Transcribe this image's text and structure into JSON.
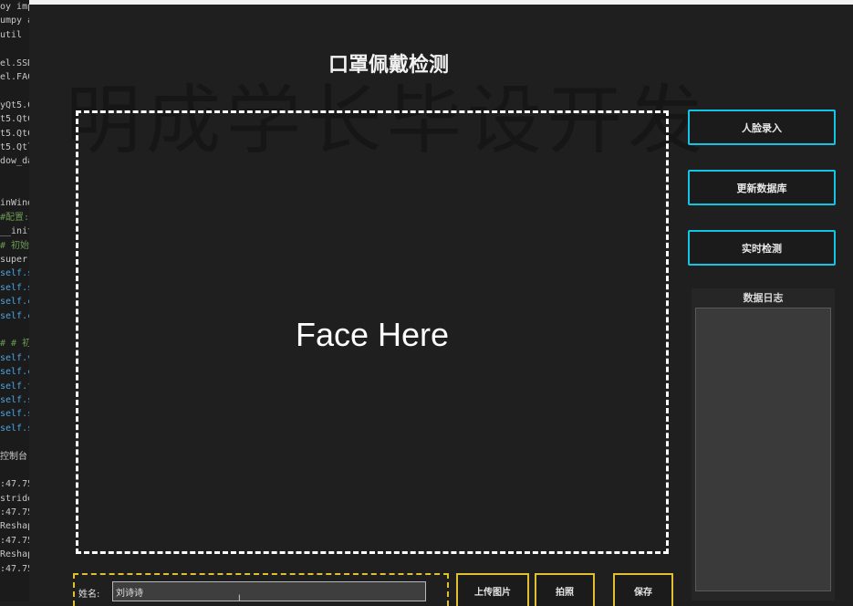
{
  "code_lines": [
    {
      "text": "oy imp",
      "cls": ""
    },
    {
      "text": "umpy a",
      "cls": ""
    },
    {
      "text": "util",
      "cls": ""
    },
    {
      "text": "",
      "cls": ""
    },
    {
      "text": "el.SSD",
      "cls": ""
    },
    {
      "text": "el.FAC",
      "cls": ""
    },
    {
      "text": "",
      "cls": ""
    },
    {
      "text": "yQt5.C",
      "cls": ""
    },
    {
      "text": "t5.QtC",
      "cls": ""
    },
    {
      "text": "t5.QtC",
      "cls": ""
    },
    {
      "text": "t5.Qtl",
      "cls": ""
    },
    {
      "text": "dow_da",
      "cls": ""
    },
    {
      "text": "",
      "cls": ""
    },
    {
      "text": "",
      "cls": ""
    },
    {
      "text": "inWind",
      "cls": ""
    },
    {
      "text": "#配置:",
      "cls": "cm"
    },
    {
      "text": "__init",
      "cls": ""
    },
    {
      "text": "# 初始",
      "cls": "cm"
    },
    {
      "text": "super(",
      "cls": ""
    },
    {
      "text": "self.s",
      "cls": "kw"
    },
    {
      "text": "self.s",
      "cls": "kw"
    },
    {
      "text": "self.c",
      "cls": "kw"
    },
    {
      "text": "self.c",
      "cls": "kw"
    },
    {
      "text": "",
      "cls": ""
    },
    {
      "text": "# # 初",
      "cls": "cm"
    },
    {
      "text": "self.v",
      "cls": "kw"
    },
    {
      "text": "self.c",
      "cls": "kw"
    },
    {
      "text": "self.t",
      "cls": "kw"
    },
    {
      "text": "self.s",
      "cls": "kw"
    },
    {
      "text": "self.s",
      "cls": "kw"
    },
    {
      "text": "self.s",
      "cls": "kw"
    },
    {
      "text": "",
      "cls": ""
    },
    {
      "text": "控制台",
      "cls": ""
    },
    {
      "text": "",
      "cls": ""
    },
    {
      "text": ":47.75",
      "cls": ""
    },
    {
      "text": "stride",
      "cls": ""
    },
    {
      "text": ":47.75",
      "cls": ""
    },
    {
      "text": "Reshap",
      "cls": ""
    },
    {
      "text": ":47.75",
      "cls": ""
    },
    {
      "text": "Reshap",
      "cls": ""
    },
    {
      "text": ":47.75",
      "cls": ""
    }
  ],
  "app": {
    "title": "口罩佩戴检测",
    "watermark": "明成学长毕设开发",
    "preview_placeholder": "Face Here"
  },
  "sidebar": {
    "face_entry_label": "人脸录入",
    "update_db_label": "更新数据库",
    "realtime_detect_label": "实时检测",
    "log_title": "数据日志"
  },
  "bottom": {
    "name_label": "姓名:",
    "name_value": "刘诗诗",
    "upload_label": "上传图片",
    "capture_label": "拍照",
    "save_label": "保存"
  },
  "colors": {
    "accent_button_border": "#13c4e4",
    "bottom_dashed_border": "#e0c030"
  }
}
